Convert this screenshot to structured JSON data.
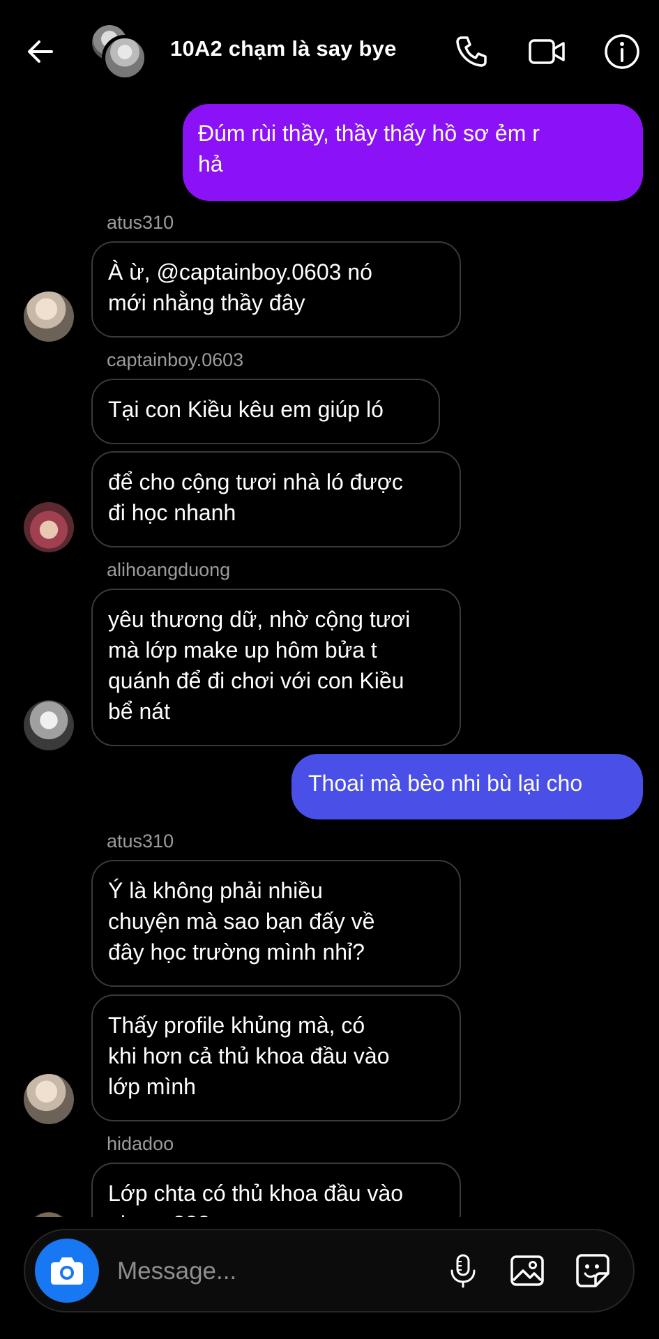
{
  "header": {
    "title": "10A2 chạm là say bye"
  },
  "messages": [
    {
      "type": "outgoing",
      "color": "#8b12f6",
      "lines": [
        "Đúm rùi thầy, thầy thấy hồ sơ ẻm r",
        "hả"
      ]
    },
    {
      "type": "sender",
      "name": "atus310"
    },
    {
      "type": "incoming",
      "lines": [
        "À ừ, @captainboy.0603 nó",
        "mới nhằng thầy đây"
      ]
    },
    {
      "type": "sender",
      "name": "captainboy.0603"
    },
    {
      "type": "incoming",
      "lines": [
        "Tại con Kiều kêu em giúp ló"
      ]
    },
    {
      "type": "incoming",
      "lines": [
        "để cho cộng tươi nhà ló được",
        "đi học nhanh"
      ]
    },
    {
      "type": "sender",
      "name": "alihoangduong"
    },
    {
      "type": "incoming",
      "lines": [
        "yêu thương dữ, nhờ cộng tươi",
        "mà lớp make up hôm bửa t",
        "quánh để đi chơi với con Kiều",
        "bể nát"
      ]
    },
    {
      "type": "outgoing",
      "color": "#4a4fe8",
      "lines": [
        "Thoai mà bèo nhi bù lại cho"
      ]
    },
    {
      "type": "sender",
      "name": "atus310"
    },
    {
      "type": "incoming",
      "lines": [
        "Ý là không phải nhiều",
        "chuyện mà sao bạn đấy về",
        "đây học trường mình nhỉ?"
      ]
    },
    {
      "type": "incoming",
      "lines": [
        "Thấy profile khủng mà, có",
        "khi hơn cả thủ khoa đầu vào",
        "lớp mình"
      ]
    },
    {
      "type": "sender",
      "name": "hidadoo"
    },
    {
      "type": "incoming",
      "lines": [
        "Lớp chta có thủ khoa đầu vào",
        "nhưng???"
      ]
    }
  ],
  "composer": {
    "placeholder": "Message..."
  },
  "icons": {
    "back": "arrow-left-icon",
    "call": "phone-icon",
    "video": "video-camera-icon",
    "info": "info-icon",
    "camera": "camera-icon",
    "mic": "microphone-icon",
    "gallery": "image-icon",
    "sticker": "sticker-icon"
  },
  "colors": {
    "background": "#000000",
    "outgoing_purple": "#8b12f6",
    "outgoing_blue": "#4a4fe8",
    "camera_button": "#1877f2"
  }
}
